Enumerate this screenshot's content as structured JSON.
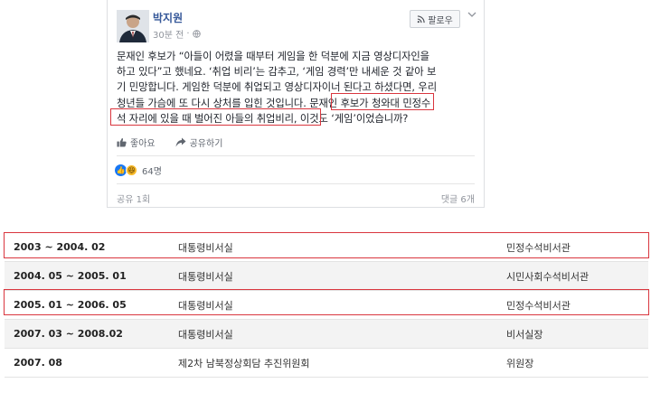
{
  "post": {
    "author": "박지원",
    "time": "30분 전",
    "follow_label": "팔로우",
    "lines": [
      "문재인 후보가 “아들이 어렸을 때부터 게임을 한 덕분에 지금 영상디자인을",
      "하고 있다”고 했네요. ‘취업 비리’는 감추고, ‘게임 경력’만 내세운 것 같아 보",
      "기 민망합니다. 게임한 덕분에 취업되고 영상디자이너 된다고 하셨다면, 우리",
      "청년들 가슴에 또 다시 상처를 입힌 것입니다. 문재인 후보가 청와대 민정수",
      "석 자리에 있을 때 벌어진 아들의 취업비리, 이것도 ‘게임’이었습니까?"
    ],
    "like_label": "좋아요",
    "share_label": "공유하기",
    "reaction_count": "64명",
    "shares": "공유 1회",
    "comments": "댓글 6개"
  },
  "career": [
    {
      "period": "2003 ~ 2004. 02",
      "org": "대통령비서실",
      "role": "민정수석비서관"
    },
    {
      "period": "2004. 05 ~ 2005. 01",
      "org": "대통령비서실",
      "role": "시민사회수석비서관"
    },
    {
      "period": "2005. 01 ~ 2006. 05",
      "org": "대통령비서실",
      "role": "민정수석비서관"
    },
    {
      "period": "2007. 03 ~ 2008.02",
      "org": "대통령비서실",
      "role": "비서실장"
    },
    {
      "period": "2007. 08",
      "org": "제2차 남북정상회담 추진위원회",
      "role": "위원장"
    }
  ],
  "colors": {
    "highlight": "#d9363e",
    "link": "#365899",
    "like": "#1877f2"
  }
}
